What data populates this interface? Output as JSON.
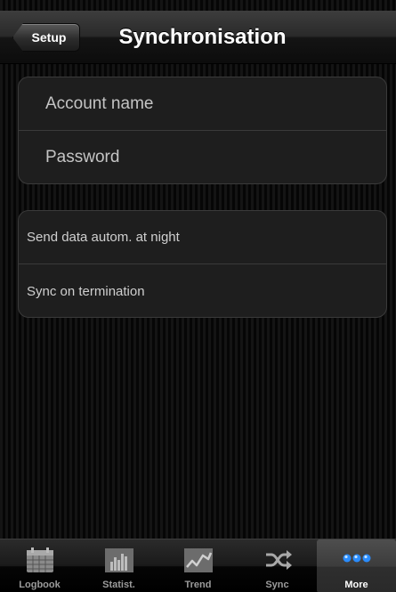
{
  "navbar": {
    "back_label": "Setup",
    "title": "Synchronisation"
  },
  "account_section": {
    "account_name_placeholder": "Account name",
    "password_placeholder": "Password"
  },
  "sync_options": {
    "items": [
      {
        "label": "Send data autom. at night"
      },
      {
        "label": "Sync on termination"
      }
    ]
  },
  "tabbar": {
    "active": "More",
    "tabs": [
      {
        "label": "Logbook",
        "icon": "calendar-icon"
      },
      {
        "label": "Statist.",
        "icon": "bar-chart-icon"
      },
      {
        "label": "Trend",
        "icon": "trend-line-icon"
      },
      {
        "label": "Sync",
        "icon": "shuffle-icon"
      },
      {
        "label": "More",
        "icon": "more-dots-icon"
      }
    ]
  },
  "colors": {
    "active_tab_accent": "#1e90ff",
    "cell_background": "#1e1e1e"
  }
}
